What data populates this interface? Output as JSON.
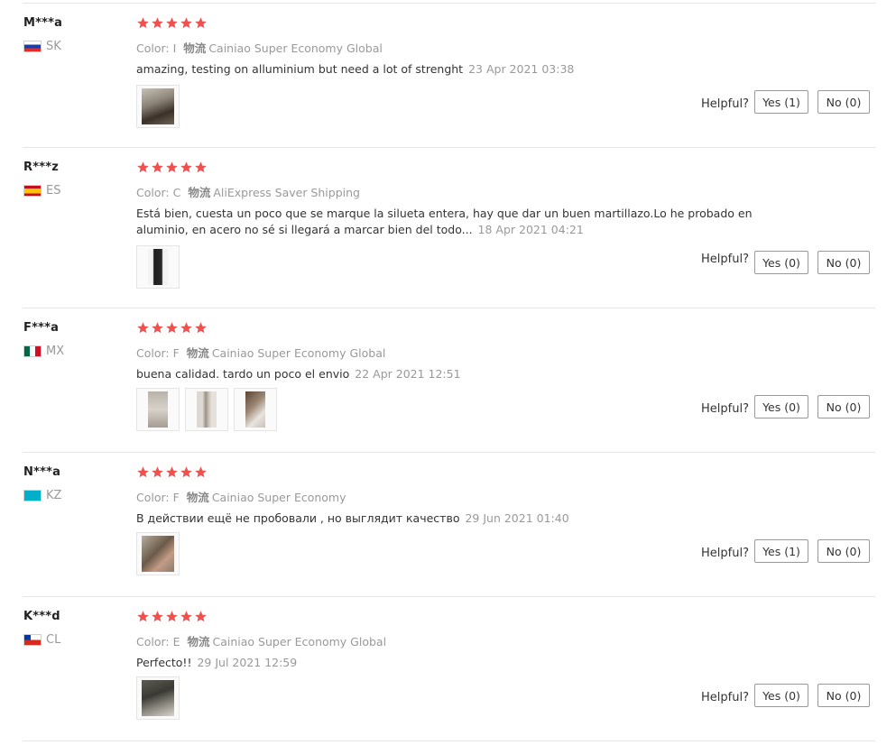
{
  "star_color": "#f05050",
  "reviews": [
    {
      "user": "M***a",
      "country": "SK",
      "flag": [
        "#ffffff",
        "#1b3fa3",
        "#e32b2b"
      ],
      "color_label": "Color: I",
      "shipping_label": "物流",
      "shipping": "Cainiao Super Economy Global",
      "text": "amazing, testing on alluminium but need a lot of strenght",
      "date": "23 Apr 2021 03:38",
      "images": 1,
      "helpful_label": "Helpful?",
      "yes": "Yes (1)",
      "no": "No (0)"
    },
    {
      "user": "R***z",
      "country": "ES",
      "flag": [
        "#c60b1e",
        "#ffc400",
        "#c60b1e"
      ],
      "color_label": "Color: C",
      "shipping_label": "物流",
      "shipping": "AliExpress Saver Shipping",
      "text": "Está bien, cuesta un poco que se marque la silueta entera, hay que dar un buen martillazo.Lo he probado en aluminio, en acero no sé si llegará a marcar bien del todo...",
      "date": "18 Apr 2021 04:21",
      "images": 1,
      "helpful_label": "Helpful?",
      "yes": "Yes (0)",
      "no": "No (0)"
    },
    {
      "user": "F***a",
      "country": "MX",
      "flag": [
        "#006847",
        "#ffffff",
        "#ce1126"
      ],
      "color_label": "Color: F",
      "shipping_label": "物流",
      "shipping": "Cainiao Super Economy Global",
      "text": "buena calidad. tardo un poco el envio",
      "date": "22 Apr 2021 12:51",
      "images": 3,
      "helpful_label": "Helpful?",
      "yes": "Yes (0)",
      "no": "No (0)"
    },
    {
      "user": "N***a",
      "country": "KZ",
      "flag": [
        "#00afca",
        "#00afca",
        "#00afca"
      ],
      "color_label": "Color: F",
      "shipping_label": "物流",
      "shipping": "Cainiao Super Economy",
      "text": "В действии ещё не пробовали , но выглядит качество",
      "date": "29 Jun 2021 01:40",
      "images": 1,
      "helpful_label": "Helpful?",
      "yes": "Yes (1)",
      "no": "No (0)"
    },
    {
      "user": "K***d",
      "country": "CL",
      "flag": [
        "#ffffff",
        "#d52b1e",
        "#0039a6"
      ],
      "color_label": "Color: E",
      "shipping_label": "物流",
      "shipping": "Cainiao Super Economy Global",
      "text": "Perfecto!!",
      "date": "29 Jul 2021 12:59",
      "images": 1,
      "helpful_label": "Helpful?",
      "yes": "Yes (0)",
      "no": "No (0)"
    }
  ]
}
